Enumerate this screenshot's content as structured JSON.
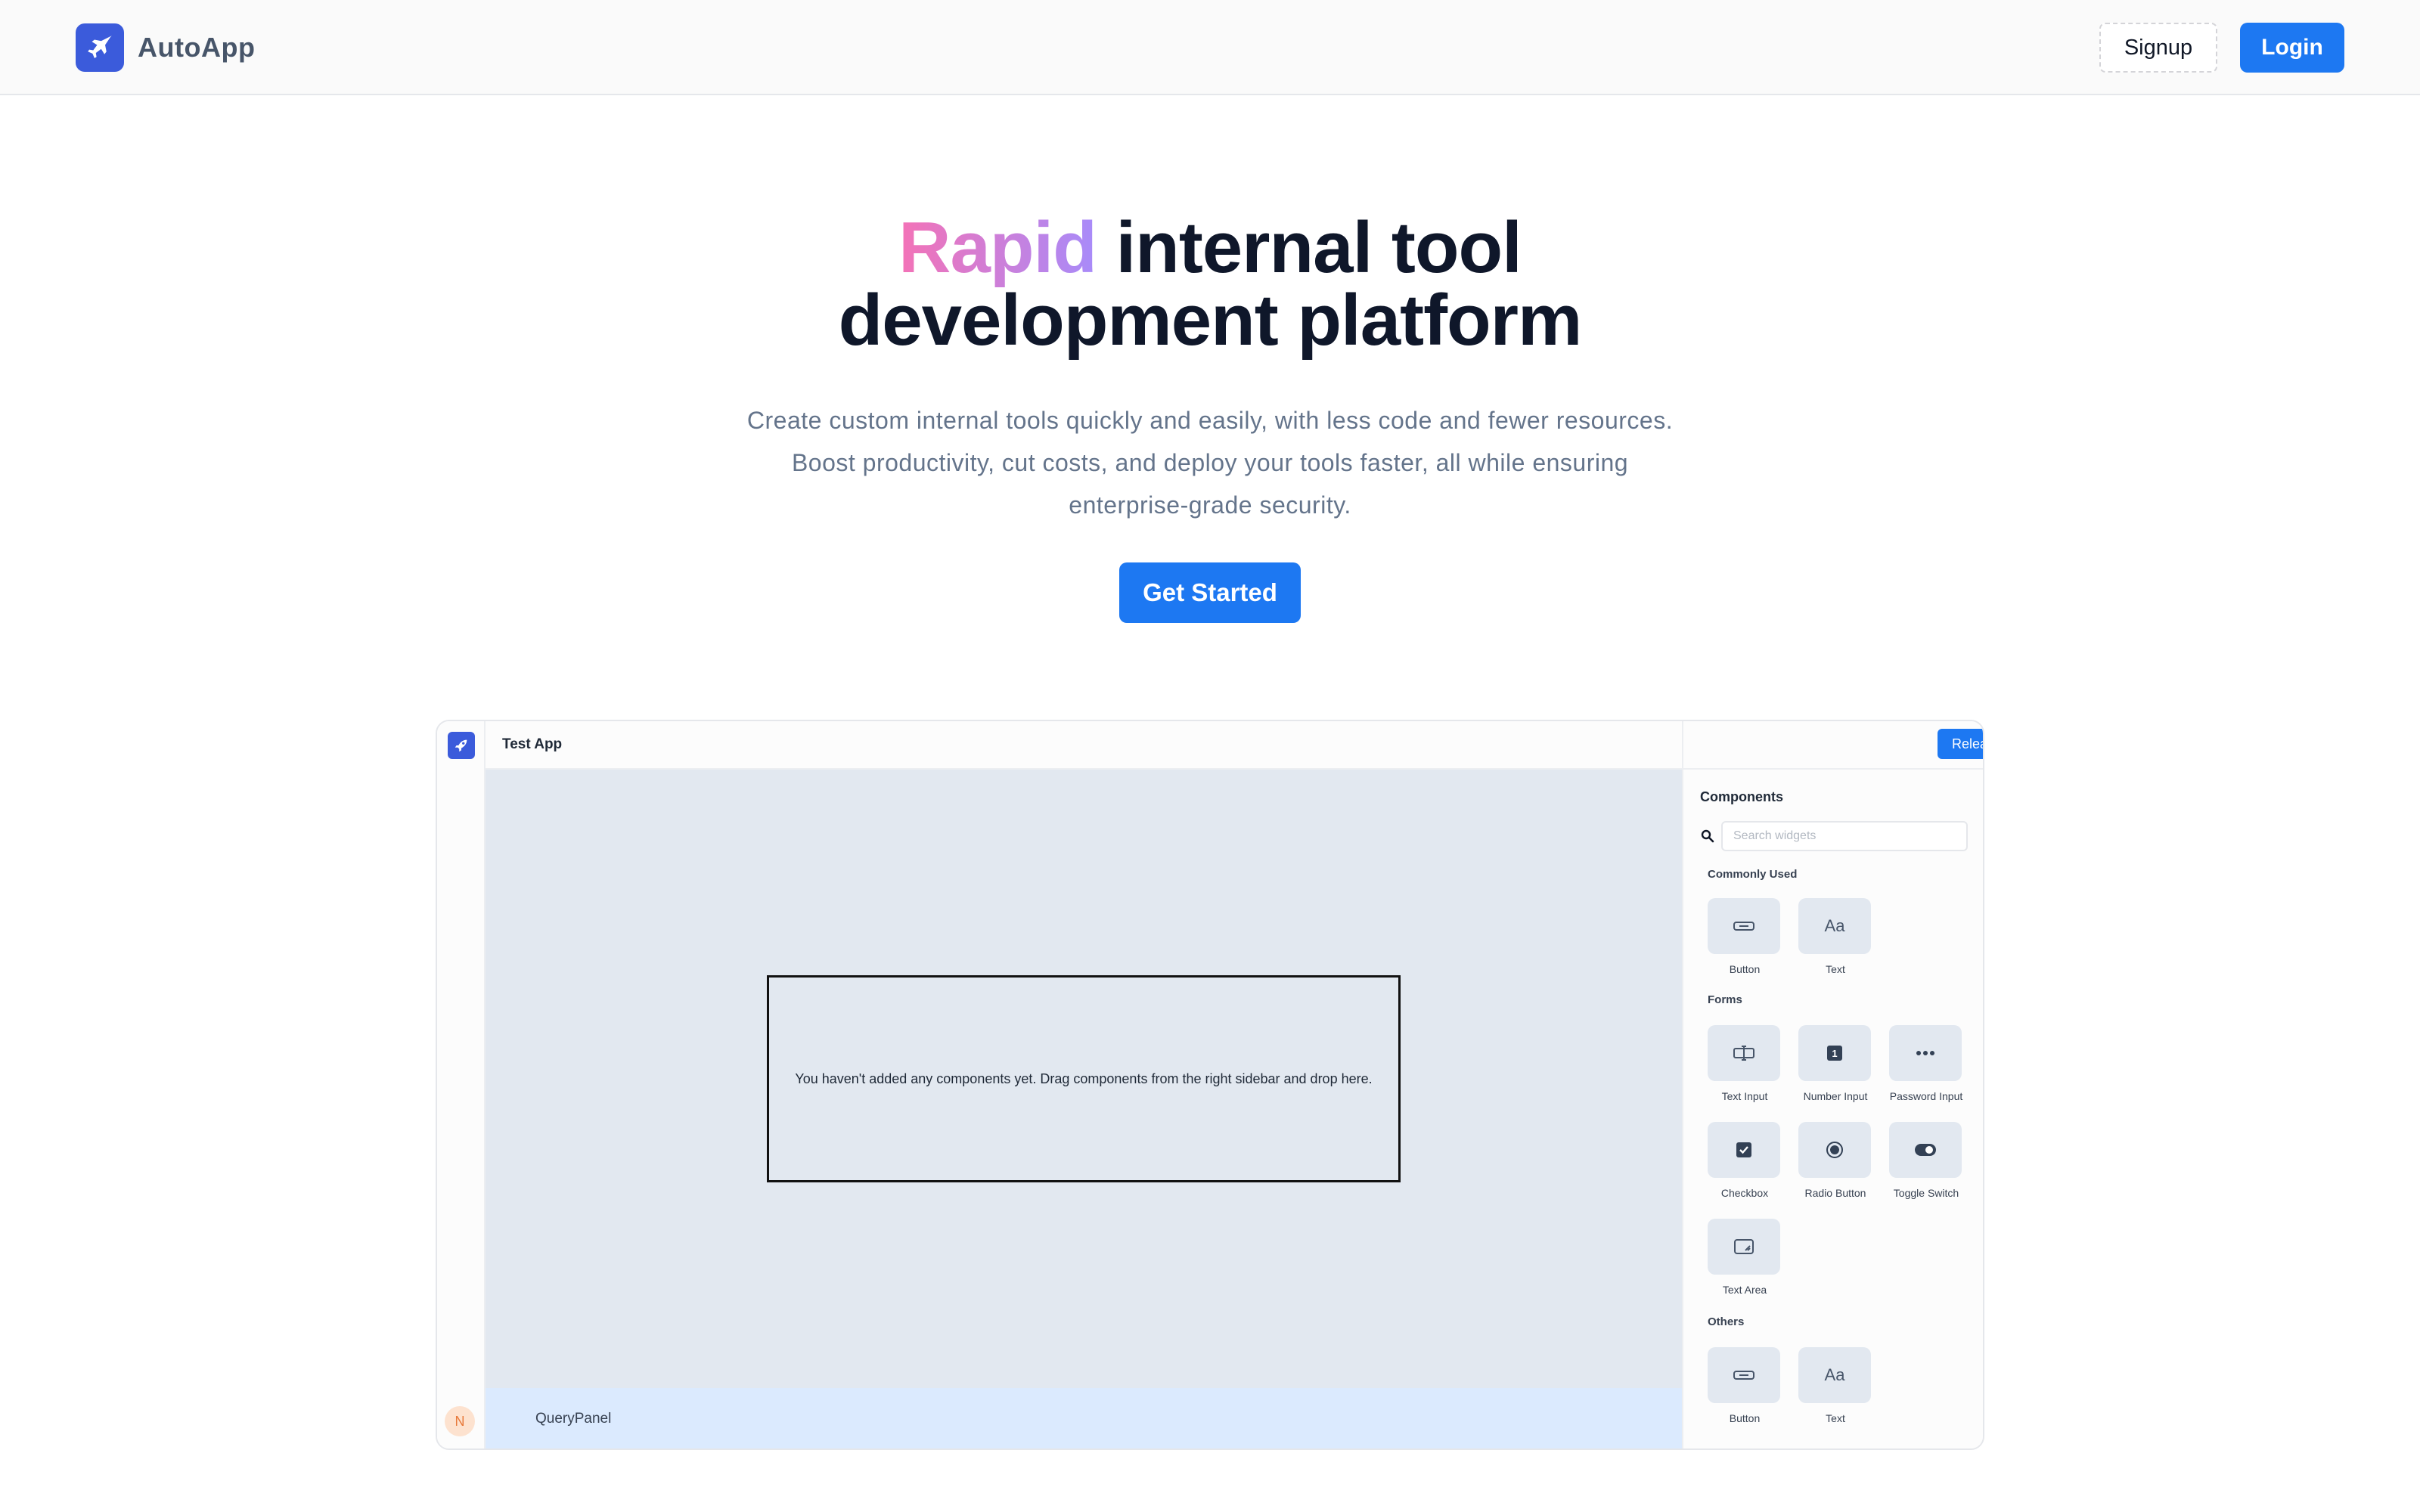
{
  "brand": {
    "name": "AutoApp",
    "logo_icon": "jet-plane-icon"
  },
  "nav": {
    "signup_label": "Signup",
    "login_label": "Login"
  },
  "hero": {
    "title_accent": "Rapid",
    "title_rest_line1": " internal tool",
    "title_line2": "development platform",
    "subtitle_line1": "Create custom internal tools quickly and easily, with less code and fewer resources.",
    "subtitle_line2": "Boost productivity, cut costs, and deploy your tools faster, all while ensuring",
    "subtitle_line3": "enterprise-grade security.",
    "cta_label": "Get Started"
  },
  "mock_app": {
    "app_title": "Test App",
    "release_label": "Release",
    "empty_canvas_message": "You haven't added any components yet. Drag components from the right sidebar and drop here.",
    "query_panel_label": "QueryPanel",
    "avatar_initial": "N",
    "sidebar": {
      "title": "Components",
      "search_placeholder": "Search widgets",
      "groups": [
        {
          "name": "Commonly Used",
          "widgets": [
            {
              "label": "Button",
              "icon": "button-icon"
            },
            {
              "label": "Text",
              "icon": "text-icon"
            }
          ]
        },
        {
          "name": "Forms",
          "widgets": [
            {
              "label": "Text Input",
              "icon": "text-input-icon"
            },
            {
              "label": "Number Input",
              "icon": "number-input-icon"
            },
            {
              "label": "Password Input",
              "icon": "password-input-icon"
            },
            {
              "label": "Checkbox",
              "icon": "checkbox-icon"
            },
            {
              "label": "Radio Button",
              "icon": "radio-button-icon"
            },
            {
              "label": "Toggle Switch",
              "icon": "toggle-switch-icon"
            },
            {
              "label": "Text Area",
              "icon": "text-area-icon"
            }
          ]
        },
        {
          "name": "Others",
          "widgets": [
            {
              "label": "Button",
              "icon": "button-icon"
            },
            {
              "label": "Text",
              "icon": "text-icon"
            }
          ]
        }
      ],
      "text_glyph": "Aa"
    }
  },
  "colors": {
    "primary": "#1d78f2",
    "logo_bg": "#3b5bdb",
    "accent_start": "#f472b6",
    "accent_end": "#a78bfa",
    "canvas_bg": "#e2e8f0",
    "query_panel_bg": "#dbeafe"
  }
}
